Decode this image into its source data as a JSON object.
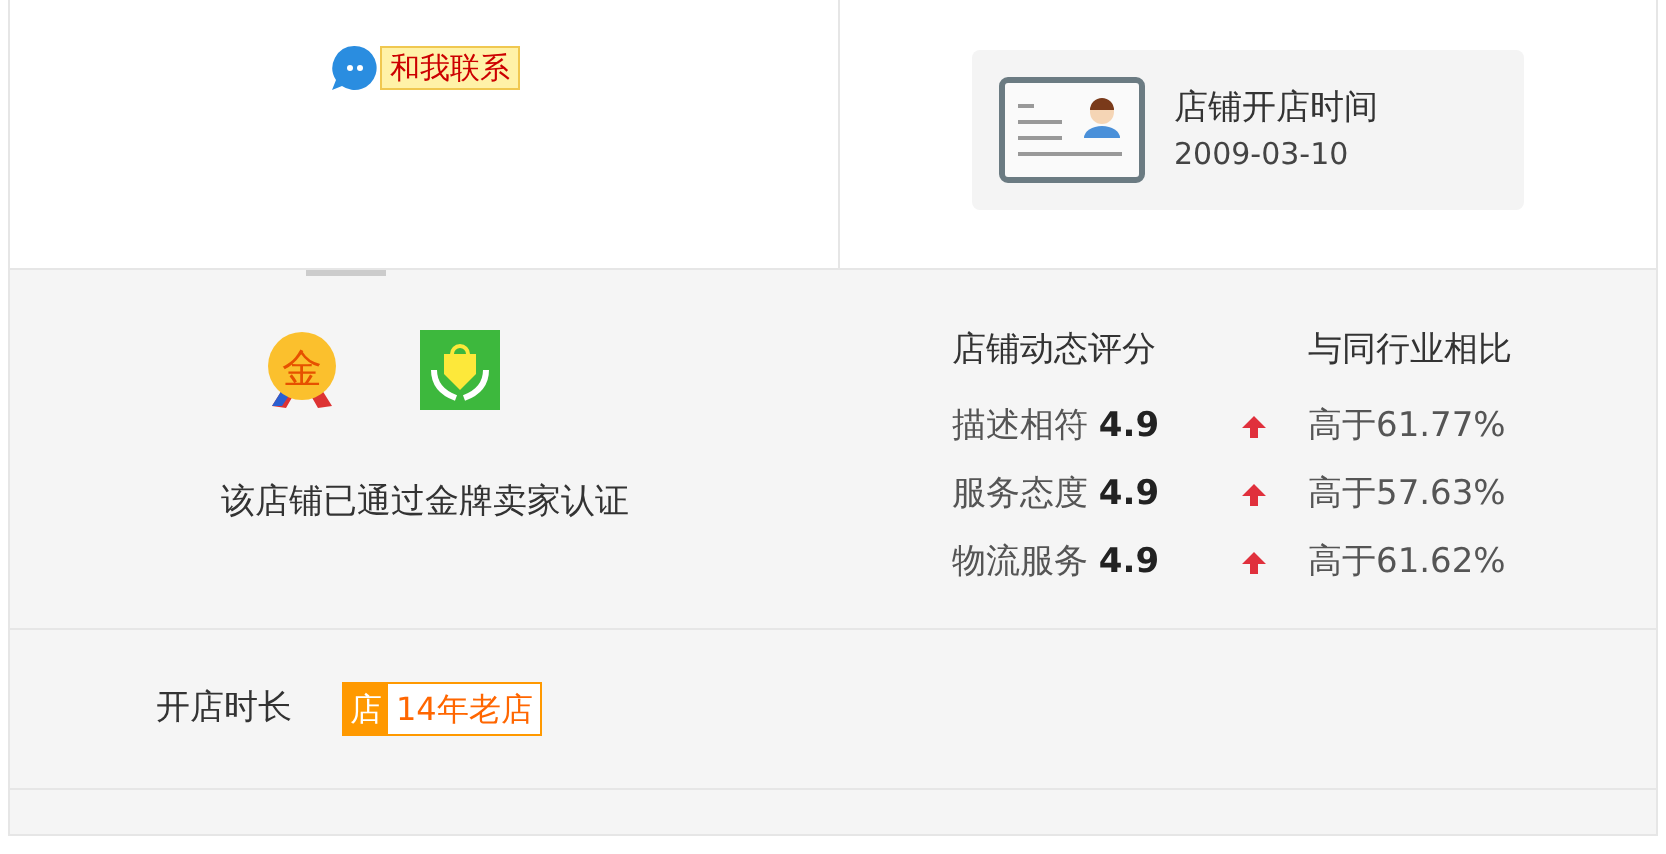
{
  "contact": {
    "label": "和我联系"
  },
  "open_date": {
    "title": "店铺开店时间",
    "date": "2009-03-10"
  },
  "certification": {
    "text": "该店铺已通过金牌卖家认证",
    "badge_char": "金"
  },
  "ratings": {
    "heading": "店铺动态评分",
    "compare_heading": "与同行业相比",
    "rows": [
      {
        "label": "描述相符",
        "score": "4.9",
        "rising": true,
        "compare": "高于61.77%"
      },
      {
        "label": "服务态度",
        "score": "4.9",
        "rising": true,
        "compare": "高于57.63%"
      },
      {
        "label": "物流服务",
        "score": "4.9",
        "rising": true,
        "compare": "高于61.62%"
      }
    ]
  },
  "shop_age": {
    "label": "开店时长",
    "tag_char": "店",
    "tag_text": "14年老店"
  }
}
